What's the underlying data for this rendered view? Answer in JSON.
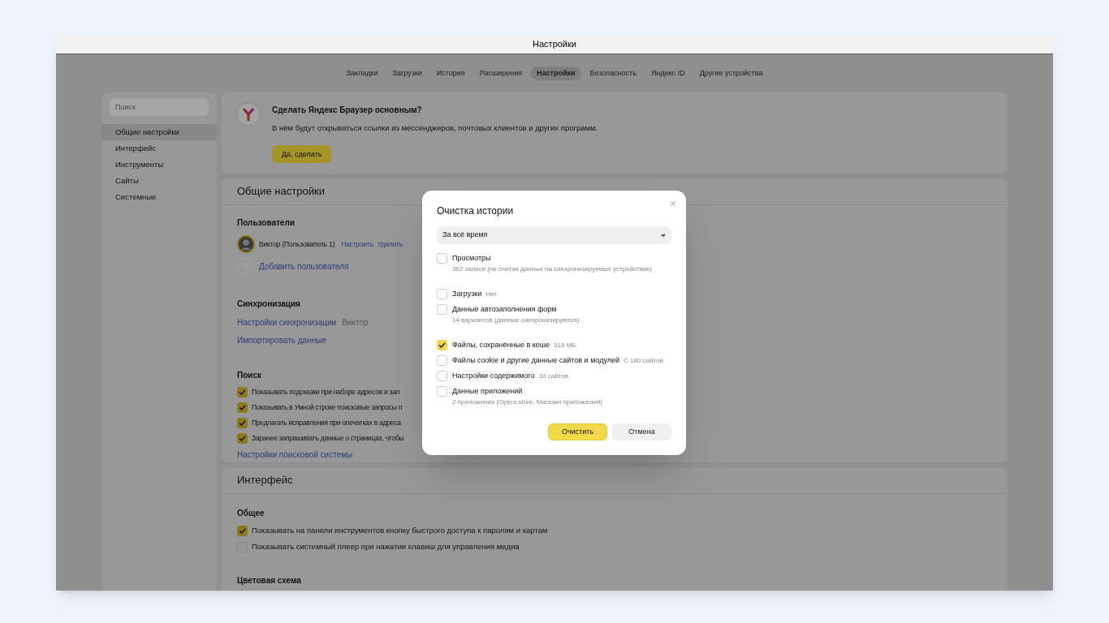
{
  "window": {
    "title": "Настройки"
  },
  "tabs": [
    {
      "label": "Закладки",
      "selected": false
    },
    {
      "label": "Загрузки",
      "selected": false
    },
    {
      "label": "История",
      "selected": false
    },
    {
      "label": "Расширения",
      "selected": false
    },
    {
      "label": "Настройки",
      "selected": true
    },
    {
      "label": "Безопасность",
      "selected": false
    },
    {
      "label": "Яндекс ID",
      "selected": false
    },
    {
      "label": "Другие устройства",
      "selected": false
    }
  ],
  "sidebar": {
    "search": {
      "placeholder": "Поиск"
    },
    "items": [
      {
        "label": "Общие настройки",
        "selected": true
      },
      {
        "label": "Интерфейс",
        "selected": false
      },
      {
        "label": "Инструменты",
        "selected": false
      },
      {
        "label": "Сайты",
        "selected": false
      },
      {
        "label": "Системные",
        "selected": false
      }
    ]
  },
  "promo": {
    "title": "Сделать Яндекс Браузер основным?",
    "text": "В нём будут открываться ссылки из мессенджеров, почтовых клиентов и других программ.",
    "button": "Да, сделать"
  },
  "general": {
    "title": "Общие настройки",
    "users": {
      "heading": "Пользователи",
      "user": "Виктор (Пользователь 1)",
      "actions": [
        "Настроить",
        "Удалить"
      ],
      "add": "Добавить пользователя"
    },
    "sync": {
      "heading": "Синхронизация",
      "link": "Настройки синхронизации",
      "account": "Виктор",
      "import": "Импортировать данные"
    },
    "search": {
      "heading": "Поиск",
      "options": [
        {
          "label": "Показывать подсказки при наборе адресов и зап",
          "checked": true
        },
        {
          "label": "Показывать в Умной строке поисковые запросы п",
          "checked": true
        },
        {
          "label": "Предлагать исправления при опечатках в адреса",
          "checked": true
        },
        {
          "label": "Заранее запрашивать данные о страницах, чтобы",
          "checked": true
        }
      ],
      "link": "Настройки поисковой системы"
    }
  },
  "interface": {
    "title": "Интерфейс",
    "heading": "Общее",
    "options": [
      {
        "label": "Показывать на панели инструментов кнопку быстрого доступа к паролям и картам",
        "checked": true
      },
      {
        "label": "Показывать системный плеер при нажатии клавиш для управления медиа",
        "checked": false
      }
    ],
    "next_heading": "Цветовая схема"
  },
  "dialog": {
    "title": "Очистка истории",
    "period": "За всё время",
    "groups": [
      [
        {
          "label": "Просмотры",
          "detail": "362 записи (не считая данных на синхронизируемых устройствах)",
          "checked": false
        }
      ],
      [
        {
          "label": "Загрузки",
          "note": "Нет",
          "checked": false
        },
        {
          "label": "Данные автозаполнения форм",
          "detail": "14 вариантов (данные синхронизируются)",
          "checked": false
        }
      ],
      [
        {
          "label": "Файлы, сохранённые в кеше",
          "note": "319 МБ",
          "checked": true
        },
        {
          "label": "Файлы cookie и другие данные сайтов и модулей",
          "note": "С 180 сайтов",
          "checked": false
        },
        {
          "label": "Настройки содержимого",
          "note": "10 сайтов",
          "checked": false
        },
        {
          "label": "Данные приложений",
          "detail": "2 приложения (Opera store, Магазин приложений)",
          "checked": false
        }
      ]
    ],
    "buttons": {
      "confirm": "Очистить",
      "cancel": "Отмена"
    }
  }
}
